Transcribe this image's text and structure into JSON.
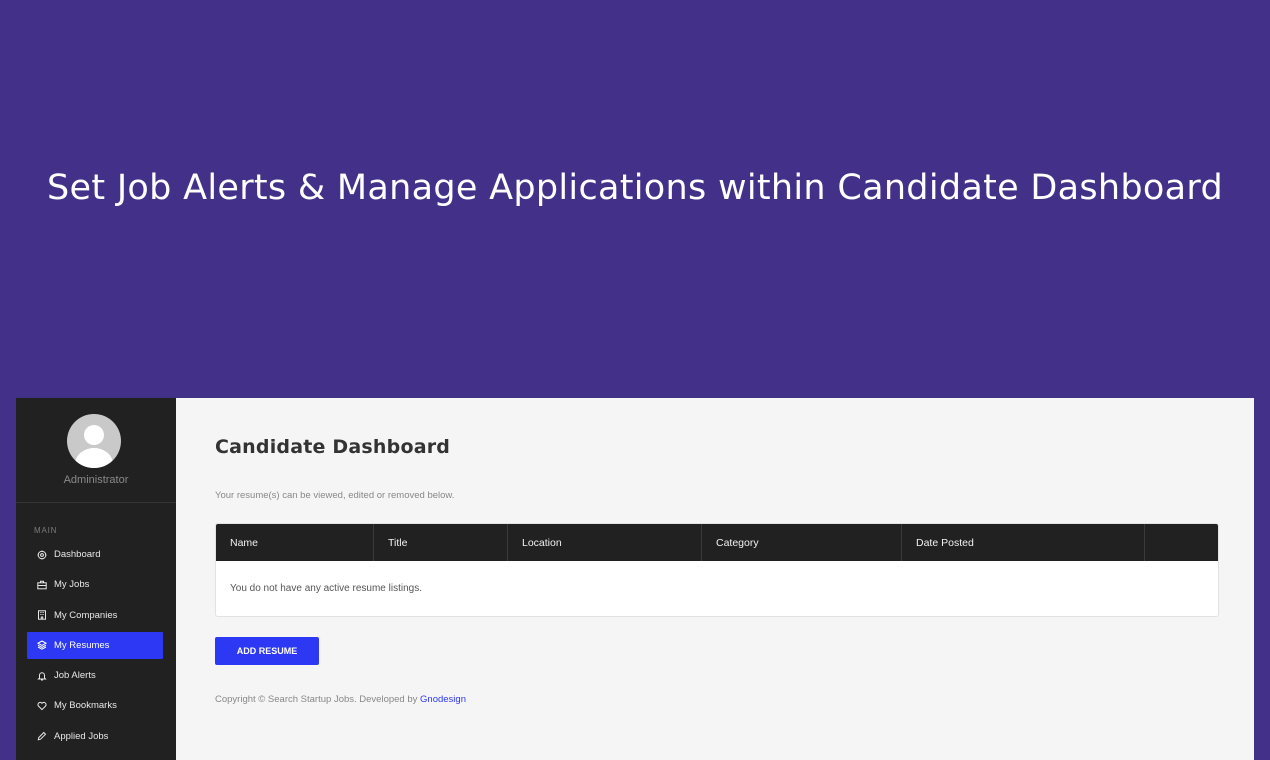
{
  "hero": {
    "title": "Set Job Alerts & Manage Applications within Candidate Dashboard"
  },
  "sidebar": {
    "user_name": "Administrator",
    "section_label": "MAIN",
    "items": [
      {
        "label": "Dashboard",
        "icon": "gauge-icon",
        "active": false
      },
      {
        "label": "My Jobs",
        "icon": "briefcase-icon",
        "active": false
      },
      {
        "label": "My Companies",
        "icon": "building-icon",
        "active": false
      },
      {
        "label": "My Resumes",
        "icon": "layers-icon",
        "active": true
      },
      {
        "label": "Job Alerts",
        "icon": "bell-icon",
        "active": false
      },
      {
        "label": "My Bookmarks",
        "icon": "heart-icon",
        "active": false
      },
      {
        "label": "Applied Jobs",
        "icon": "pencil-icon",
        "active": false
      }
    ]
  },
  "main": {
    "title": "Candidate Dashboard",
    "subtitle": "Your resume(s) can be viewed, edited or removed below.",
    "table": {
      "columns": [
        "Name",
        "Title",
        "Location",
        "Category",
        "Date Posted",
        ""
      ],
      "empty_message": "You do not have any active resume listings."
    },
    "add_button_label": "ADD RESUME",
    "footer": {
      "copyright_text": "Copyright © Search Startup Jobs. Developed by ",
      "link_text": "Gnodesign"
    }
  },
  "colors": {
    "background": "#433088",
    "sidebar": "#212122",
    "accent": "#2c38f4"
  }
}
